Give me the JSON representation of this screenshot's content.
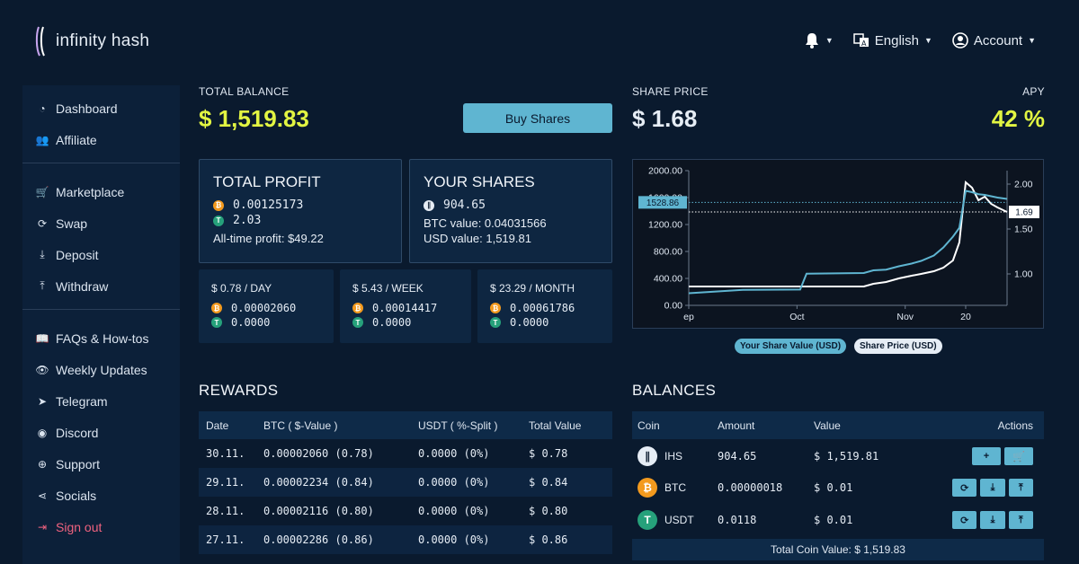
{
  "brand": {
    "name": "infinity hash"
  },
  "header": {
    "language": "English",
    "account": "Account"
  },
  "sidebar": {
    "groups": [
      [
        {
          "label": "Dashboard",
          "icon": "dashboard-icon"
        },
        {
          "label": "Affiliate",
          "icon": "users-icon"
        }
      ],
      [
        {
          "label": "Marketplace",
          "icon": "cart-icon"
        },
        {
          "label": "Swap",
          "icon": "swap-icon"
        },
        {
          "label": "Deposit",
          "icon": "download-icon"
        },
        {
          "label": "Withdraw",
          "icon": "upload-icon"
        }
      ],
      [
        {
          "label": "FAQs & How-tos",
          "icon": "book-icon"
        },
        {
          "label": "Weekly Updates",
          "icon": "eye-icon"
        },
        {
          "label": "Telegram",
          "icon": "telegram-icon"
        },
        {
          "label": "Discord",
          "icon": "discord-icon"
        },
        {
          "label": "Support",
          "icon": "lifebuoy-icon"
        },
        {
          "label": "Socials",
          "icon": "share-icon"
        },
        {
          "label": "Sign out",
          "icon": "sign-out-icon"
        }
      ]
    ]
  },
  "balance": {
    "label": "TOTAL BALANCE",
    "value": "$ 1,519.83",
    "buy_label": "Buy Shares"
  },
  "share_price": {
    "label": "SHARE PRICE",
    "value": "$ 1.68",
    "apy_label": "APY",
    "apy_value": "42 %"
  },
  "total_profit": {
    "title": "TOTAL PROFIT",
    "btc": "0.00125173",
    "usdt": "2.03",
    "alltime": "All-time profit: $49.22"
  },
  "your_shares": {
    "title": "YOUR SHARES",
    "amount": "904.65",
    "btc_value": "BTC value: 0.04031566",
    "usd_value": "USD value: 1,519.81"
  },
  "periods": [
    {
      "label": "$ 0.78 / DAY",
      "btc": "0.00002060",
      "usdt": "0.0000"
    },
    {
      "label": "$ 5.43 / WEEK",
      "btc": "0.00014417",
      "usdt": "0.0000"
    },
    {
      "label": "$ 23.29 / MONTH",
      "btc": "0.00061786",
      "usdt": "0.0000"
    }
  ],
  "chart_data": {
    "type": "line",
    "x_ticks": [
      "ep",
      "Oct",
      "Nov",
      "20"
    ],
    "y_left_ticks": [
      "0.00",
      "400.00",
      "800.00",
      "1200.00",
      "1600.00",
      "2000.00"
    ],
    "y_left_range": [
      0,
      2000
    ],
    "y_right_ticks": [
      "1.00",
      "1.50",
      "2.00"
    ],
    "y_right_range": [
      0.65,
      2.15
    ],
    "highlight_left": "1528.86",
    "highlight_right": "1.69",
    "grid": false,
    "x": [
      0,
      0.17,
      0.35,
      0.37,
      0.55,
      0.58,
      0.62,
      0.66,
      0.7,
      0.73,
      0.77,
      0.8,
      0.83,
      0.85,
      0.87,
      0.89,
      0.91,
      0.93,
      0.95,
      0.97,
      1.0
    ],
    "series": [
      {
        "name": "Your Share Value (USD)",
        "color": "#5fb5d1",
        "values": [
          180,
          230,
          235,
          470,
          480,
          520,
          530,
          580,
          620,
          660,
          740,
          860,
          1020,
          1150,
          1700,
          1680,
          1650,
          1640,
          1620,
          1600,
          1580
        ]
      },
      {
        "name": "Share Price (USD)",
        "color": "#ffffff",
        "values": [
          0.86,
          0.86,
          0.86,
          0.86,
          0.86,
          0.89,
          0.91,
          0.95,
          0.98,
          1.0,
          1.03,
          1.07,
          1.15,
          1.35,
          2.02,
          1.96,
          1.82,
          1.86,
          1.78,
          1.74,
          1.69
        ]
      }
    ],
    "legend": "bottom"
  },
  "rewards": {
    "title": "REWARDS",
    "headers": [
      "Date",
      "BTC ( $-Value )",
      "USDT ( %-Split )",
      "Total Value"
    ],
    "rows": [
      [
        "30.11.",
        "0.00002060 (0.78)",
        "0.0000 (0%)",
        "$ 0.78"
      ],
      [
        "29.11.",
        "0.00002234 (0.84)",
        "0.0000 (0%)",
        "$ 0.84"
      ],
      [
        "28.11.",
        "0.00002116 (0.80)",
        "0.0000 (0%)",
        "$ 0.80"
      ],
      [
        "27.11.",
        "0.00002286 (0.86)",
        "0.0000 (0%)",
        "$ 0.86"
      ]
    ]
  },
  "balances": {
    "title": "BALANCES",
    "headers": [
      "Coin",
      "Amount",
      "Value",
      "Actions"
    ],
    "rows": [
      {
        "coin": "IHS",
        "amount": "904.65",
        "value": "$ 1,519.81"
      },
      {
        "coin": "BTC",
        "amount": "0.00000018",
        "value": "$ 0.01"
      },
      {
        "coin": "USDT",
        "amount": "0.0118",
        "value": "$ 0.01"
      }
    ],
    "total": "Total Coin Value: $ 1,519.83"
  }
}
